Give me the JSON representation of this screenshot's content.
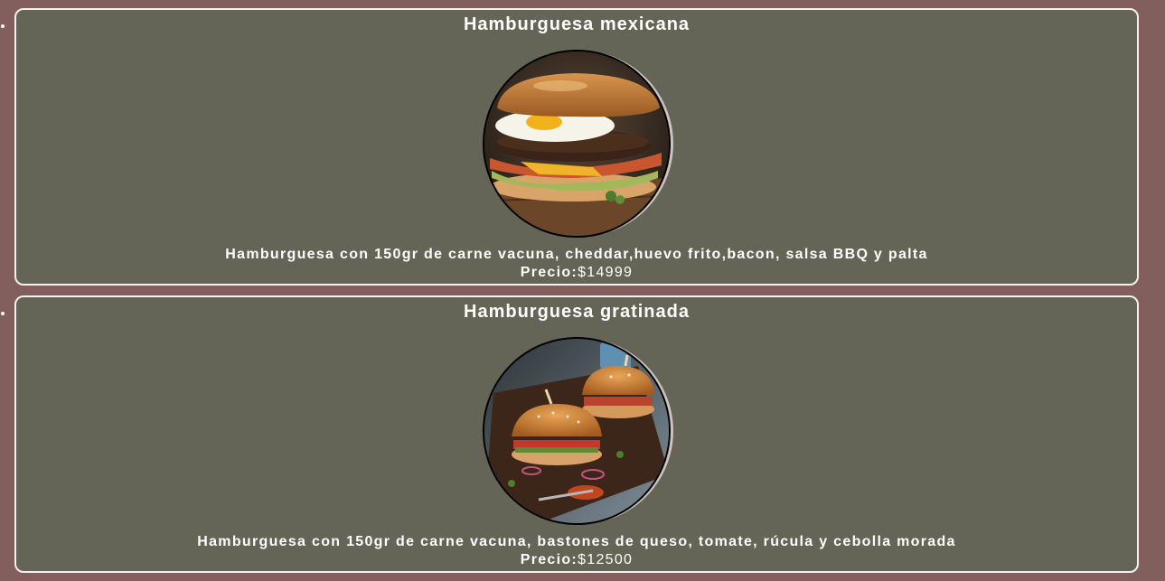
{
  "menu": {
    "items": [
      {
        "title": "Hamburguesa mexicana",
        "image_icon": "burger-egg-bacon-photo",
        "description": "Hamburguesa con 150gr de carne vacuna, cheddar,huevo frito,bacon, salsa BBQ y palta",
        "price_label": "Precio:",
        "price": "$14999"
      },
      {
        "title": "Hamburguesa gratinada",
        "image_icon": "two-sliders-on-board-photo",
        "description": "Hamburguesa con 150gr de carne vacuna, bastones de queso, tomate, rúcula y cebolla morada",
        "price_label": "Precio:",
        "price": "$12500"
      }
    ]
  },
  "colors": {
    "page_background": "#825f5d",
    "card_background": "#646556",
    "card_border": "#f3f0ee",
    "text": "#ffffff"
  }
}
